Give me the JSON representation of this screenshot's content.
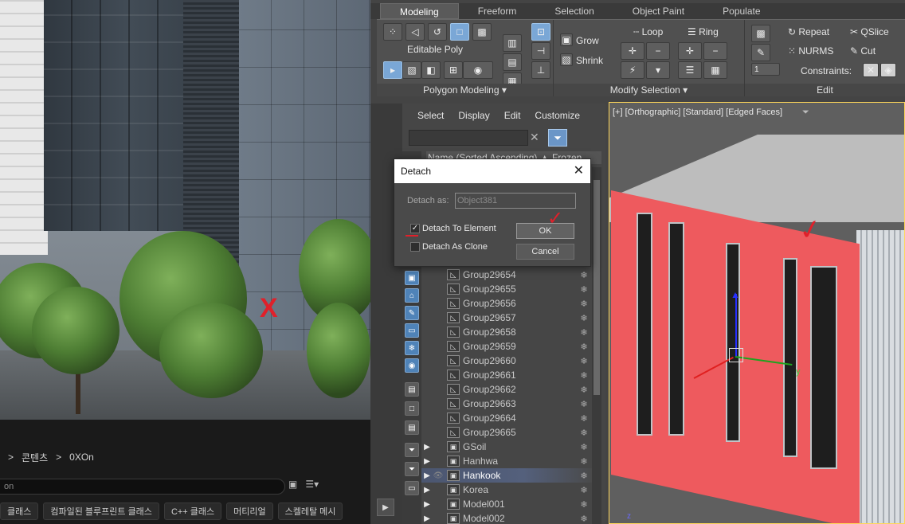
{
  "ue": {
    "breadcrumb": [
      ">",
      "콘텐츠",
      ">",
      "0XOn"
    ],
    "search_value": "on",
    "filter_chips": [
      "클래스",
      "컴파일된 블루프린트 클래스",
      "C++ 클래스",
      "머티리얼",
      "스켈레탈 메시"
    ],
    "annotation_x": "X"
  },
  "max": {
    "ribbon_tabs": [
      "Modeling",
      "Freeform",
      "Selection",
      "Object Paint",
      "Populate"
    ],
    "editable_poly": "Editable Poly",
    "grow": "Grow",
    "shrink": "Shrink",
    "loop": "Loop",
    "ring": "Ring",
    "repeat": "Repeat",
    "qslice": "QSlice",
    "nurms": "NURMS",
    "cut": "Cut",
    "constraints": "Constraints:",
    "spinner_value": "1",
    "panel_titles": {
      "polygon_modeling": "Polygon Modeling",
      "modify_selection": "Modify Selection",
      "edit": "Edit"
    },
    "scene_menu": [
      "Select",
      "Display",
      "Edit",
      "Customize"
    ],
    "scene_header": "Name (Sorted Ascending)  ▲ Frozen",
    "scene_rows": [
      {
        "name": "Group29654",
        "expander": "",
        "eye": ""
      },
      {
        "name": "Group29655",
        "expander": "",
        "eye": ""
      },
      {
        "name": "Group29656",
        "expander": "",
        "eye": ""
      },
      {
        "name": "Group29657",
        "expander": "",
        "eye": ""
      },
      {
        "name": "Group29658",
        "expander": "",
        "eye": ""
      },
      {
        "name": "Group29659",
        "expander": "",
        "eye": ""
      },
      {
        "name": "Group29660",
        "expander": "",
        "eye": ""
      },
      {
        "name": "Group29661",
        "expander": "",
        "eye": ""
      },
      {
        "name": "Group29662",
        "expander": "",
        "eye": ""
      },
      {
        "name": "Group29663",
        "expander": "",
        "eye": ""
      },
      {
        "name": "Group29664",
        "expander": "",
        "eye": ""
      },
      {
        "name": "Group29665",
        "expander": "",
        "eye": ""
      },
      {
        "name": "GSoil",
        "expander": "▶",
        "eye": ""
      },
      {
        "name": "Hanhwa",
        "expander": "▶",
        "eye": ""
      },
      {
        "name": "Hankook",
        "expander": "▶",
        "eye": "👁",
        "highlighted": true
      },
      {
        "name": "Korea",
        "expander": "▶",
        "eye": ""
      },
      {
        "name": "Model001",
        "expander": "▶",
        "eye": ""
      },
      {
        "name": "Model002",
        "expander": "▶",
        "eye": ""
      }
    ],
    "viewport_label": "[+] [Orthographic] [Standard] [Edged Faces]",
    "axis_y": "y",
    "axis_z": "z"
  },
  "dialog": {
    "title": "Detach",
    "close": "✕",
    "detach_as_label": "Detach as:",
    "detach_as_value": "Object381",
    "detach_to_element": "Detach To Element",
    "detach_to_element_checked": "✓",
    "detach_as_clone": "Detach As Clone",
    "ok": "OK",
    "cancel": "Cancel"
  }
}
